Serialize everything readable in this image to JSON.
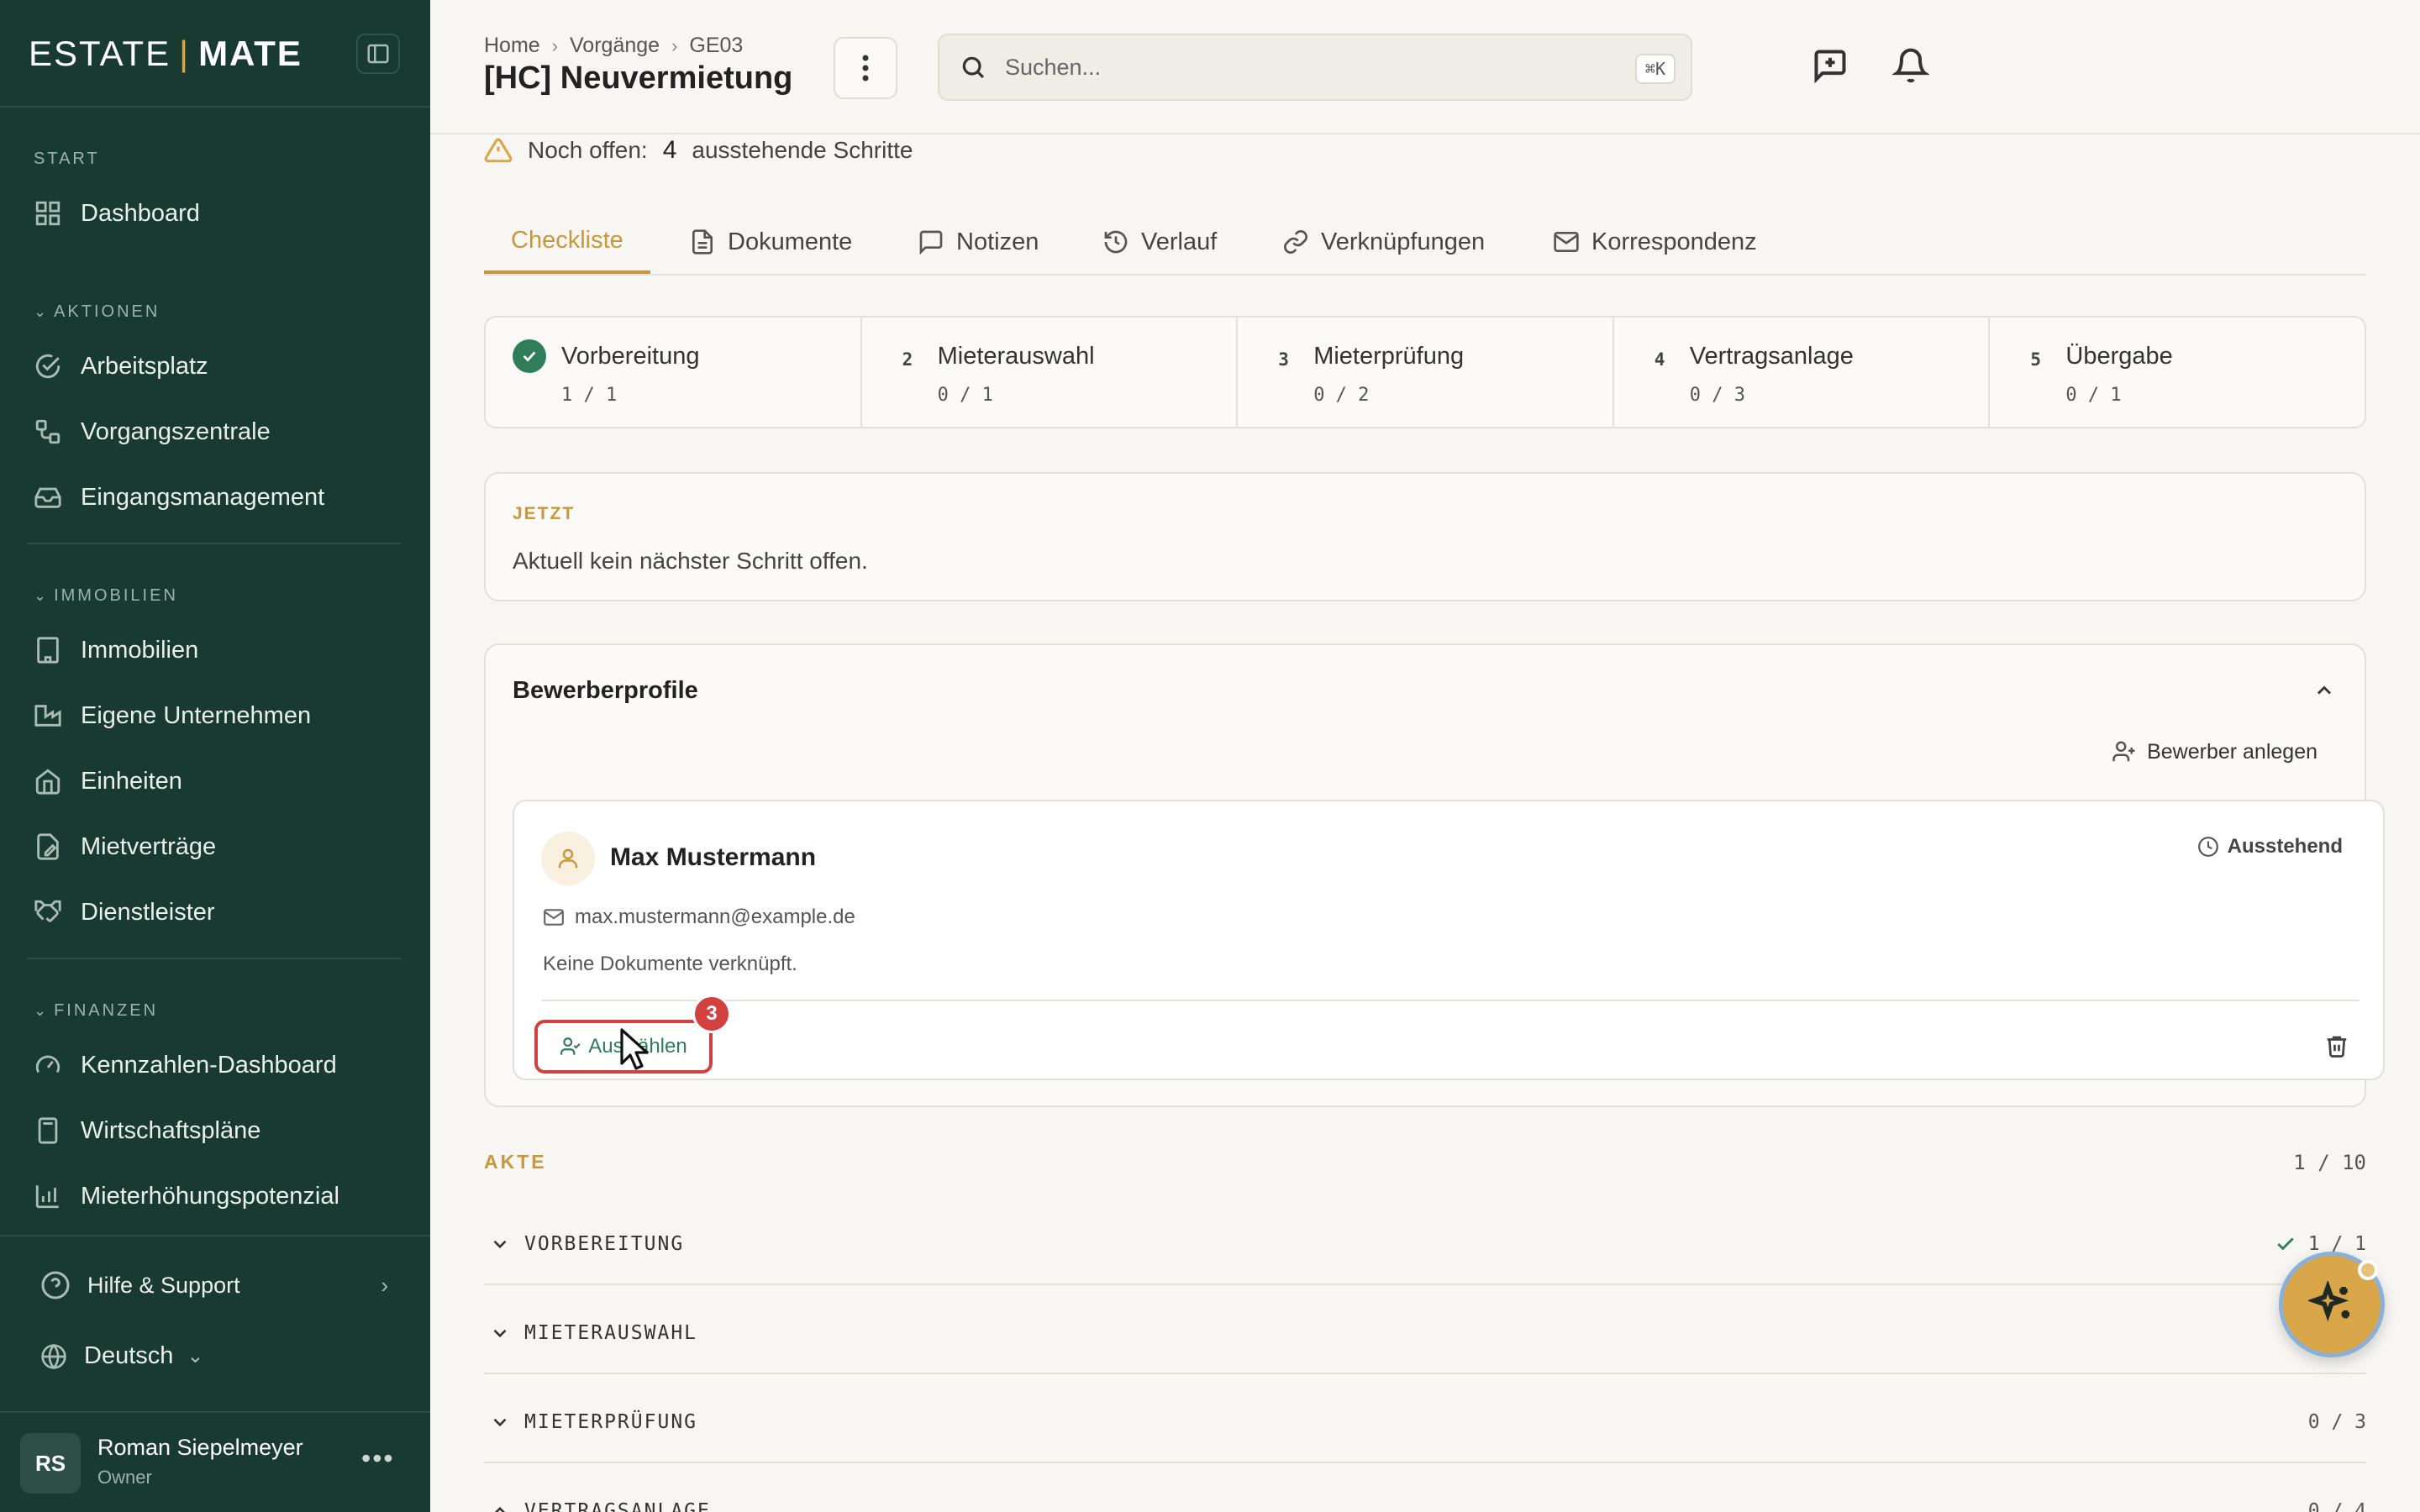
{
  "app": {
    "brand_left": "ESTATE",
    "brand_sep": "|",
    "brand_right": "MATE"
  },
  "sidebar": {
    "section_start": "START",
    "dashboard": "Dashboard",
    "section_aktionen": "AKTIONEN",
    "aktionen": [
      "Arbeitsplatz",
      "Vorgangszentrale",
      "Eingangsmanagement"
    ],
    "section_immobilien": "IMMOBILIEN",
    "immobilien": [
      "Immobilien",
      "Eigene Unternehmen",
      "Einheiten",
      "Mietverträge",
      "Dienstleister"
    ],
    "section_finanzen": "FINANZEN",
    "finanzen": [
      "Kennzahlen-Dashboard",
      "Wirtschaftspläne",
      "Mieterhöhungspotenzial"
    ],
    "help": "Hilfe & Support",
    "language": "Deutsch",
    "user": {
      "initials": "RS",
      "name": "Roman Siepelmeyer",
      "role": "Owner"
    }
  },
  "header": {
    "breadcrumbs": [
      "Home",
      "Vorgänge",
      "GE03"
    ],
    "title": "[HC] Neuvermietung",
    "search_placeholder": "Suchen...",
    "search_shortcut": "⌘K"
  },
  "main": {
    "open_prefix": "Noch offen:",
    "open_count": "4",
    "open_suffix": "ausstehende Schritte",
    "tabs": [
      "Checkliste",
      "Dokumente",
      "Notizen",
      "Verlauf",
      "Verknüpfungen",
      "Korrespondenz"
    ],
    "active_tab": "Checkliste",
    "steps": [
      {
        "num": "",
        "title": "Vorbereitung",
        "count": "1 / 1",
        "done": true
      },
      {
        "num": "2",
        "title": "Mieterauswahl",
        "count": "0 / 1",
        "done": false
      },
      {
        "num": "3",
        "title": "Mieterprüfung",
        "count": "0 / 2",
        "done": false
      },
      {
        "num": "4",
        "title": "Vertragsanlage",
        "count": "0 / 3",
        "done": false
      },
      {
        "num": "5",
        "title": "Übergabe",
        "count": "0 / 1",
        "done": false
      }
    ],
    "now": {
      "label": "JETZT",
      "text": "Aktuell kein nächster Schritt offen."
    },
    "applicants": {
      "title": "Bewerberprofile",
      "add_label": "Bewerber anlegen",
      "item": {
        "name": "Max Mustermann",
        "status": "Ausstehend",
        "email": "max.mustermann@example.de",
        "docs": "Keine Dokumente verknüpft.",
        "select_label": "Auswählen",
        "badge": "3"
      }
    },
    "akte": {
      "label": "AKTE",
      "count": "1 / 10",
      "rows": [
        {
          "label": "VORBEREITUNG",
          "count": "1 / 1",
          "done": true
        },
        {
          "label": "MIETERAUSWAHL",
          "count": ""
        },
        {
          "label": "MIETERPRÜFUNG",
          "count": "0 / 3"
        },
        {
          "label": "VERTRAGSANLAGE",
          "count": "0 / 4"
        }
      ]
    }
  },
  "colors": {
    "sidebar_bg": "#183a31",
    "accent": "#c9973c",
    "success": "#2f7d5a",
    "danger": "#d24040"
  }
}
